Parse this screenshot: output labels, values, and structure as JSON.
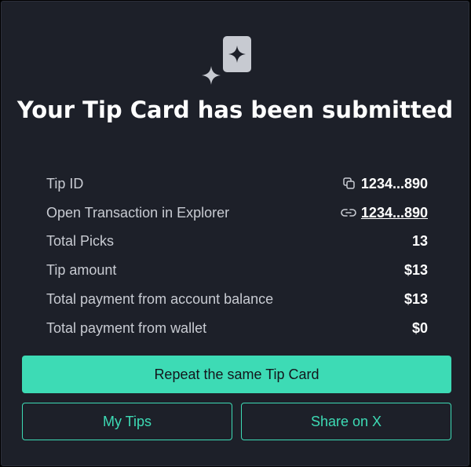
{
  "title": "Your Tip Card has been submitted",
  "details": {
    "tip_id": {
      "label": "Tip ID",
      "value": "1234...890"
    },
    "transaction": {
      "label": "Open Transaction in Explorer",
      "value": "1234...890"
    },
    "total_picks": {
      "label": "Total Picks",
      "value": "13"
    },
    "tip_amount": {
      "label": "Tip amount",
      "value": "$13"
    },
    "from_balance": {
      "label": "Total payment from account balance",
      "value": "$13"
    },
    "from_wallet": {
      "label": "Total payment from wallet",
      "value": "$0"
    }
  },
  "actions": {
    "repeat_label": "Repeat the same Tip Card",
    "my_tips_label": "My Tips",
    "share_label": "Share on X"
  },
  "colors": {
    "background": "#1d2029",
    "accent": "#3ddbb5",
    "text": "#ffffff",
    "muted_text": "#c8cbd2"
  },
  "icons": {
    "header": "tip-card-sparkle-icon",
    "tip_id": "copy-icon",
    "transaction": "link-icon"
  }
}
